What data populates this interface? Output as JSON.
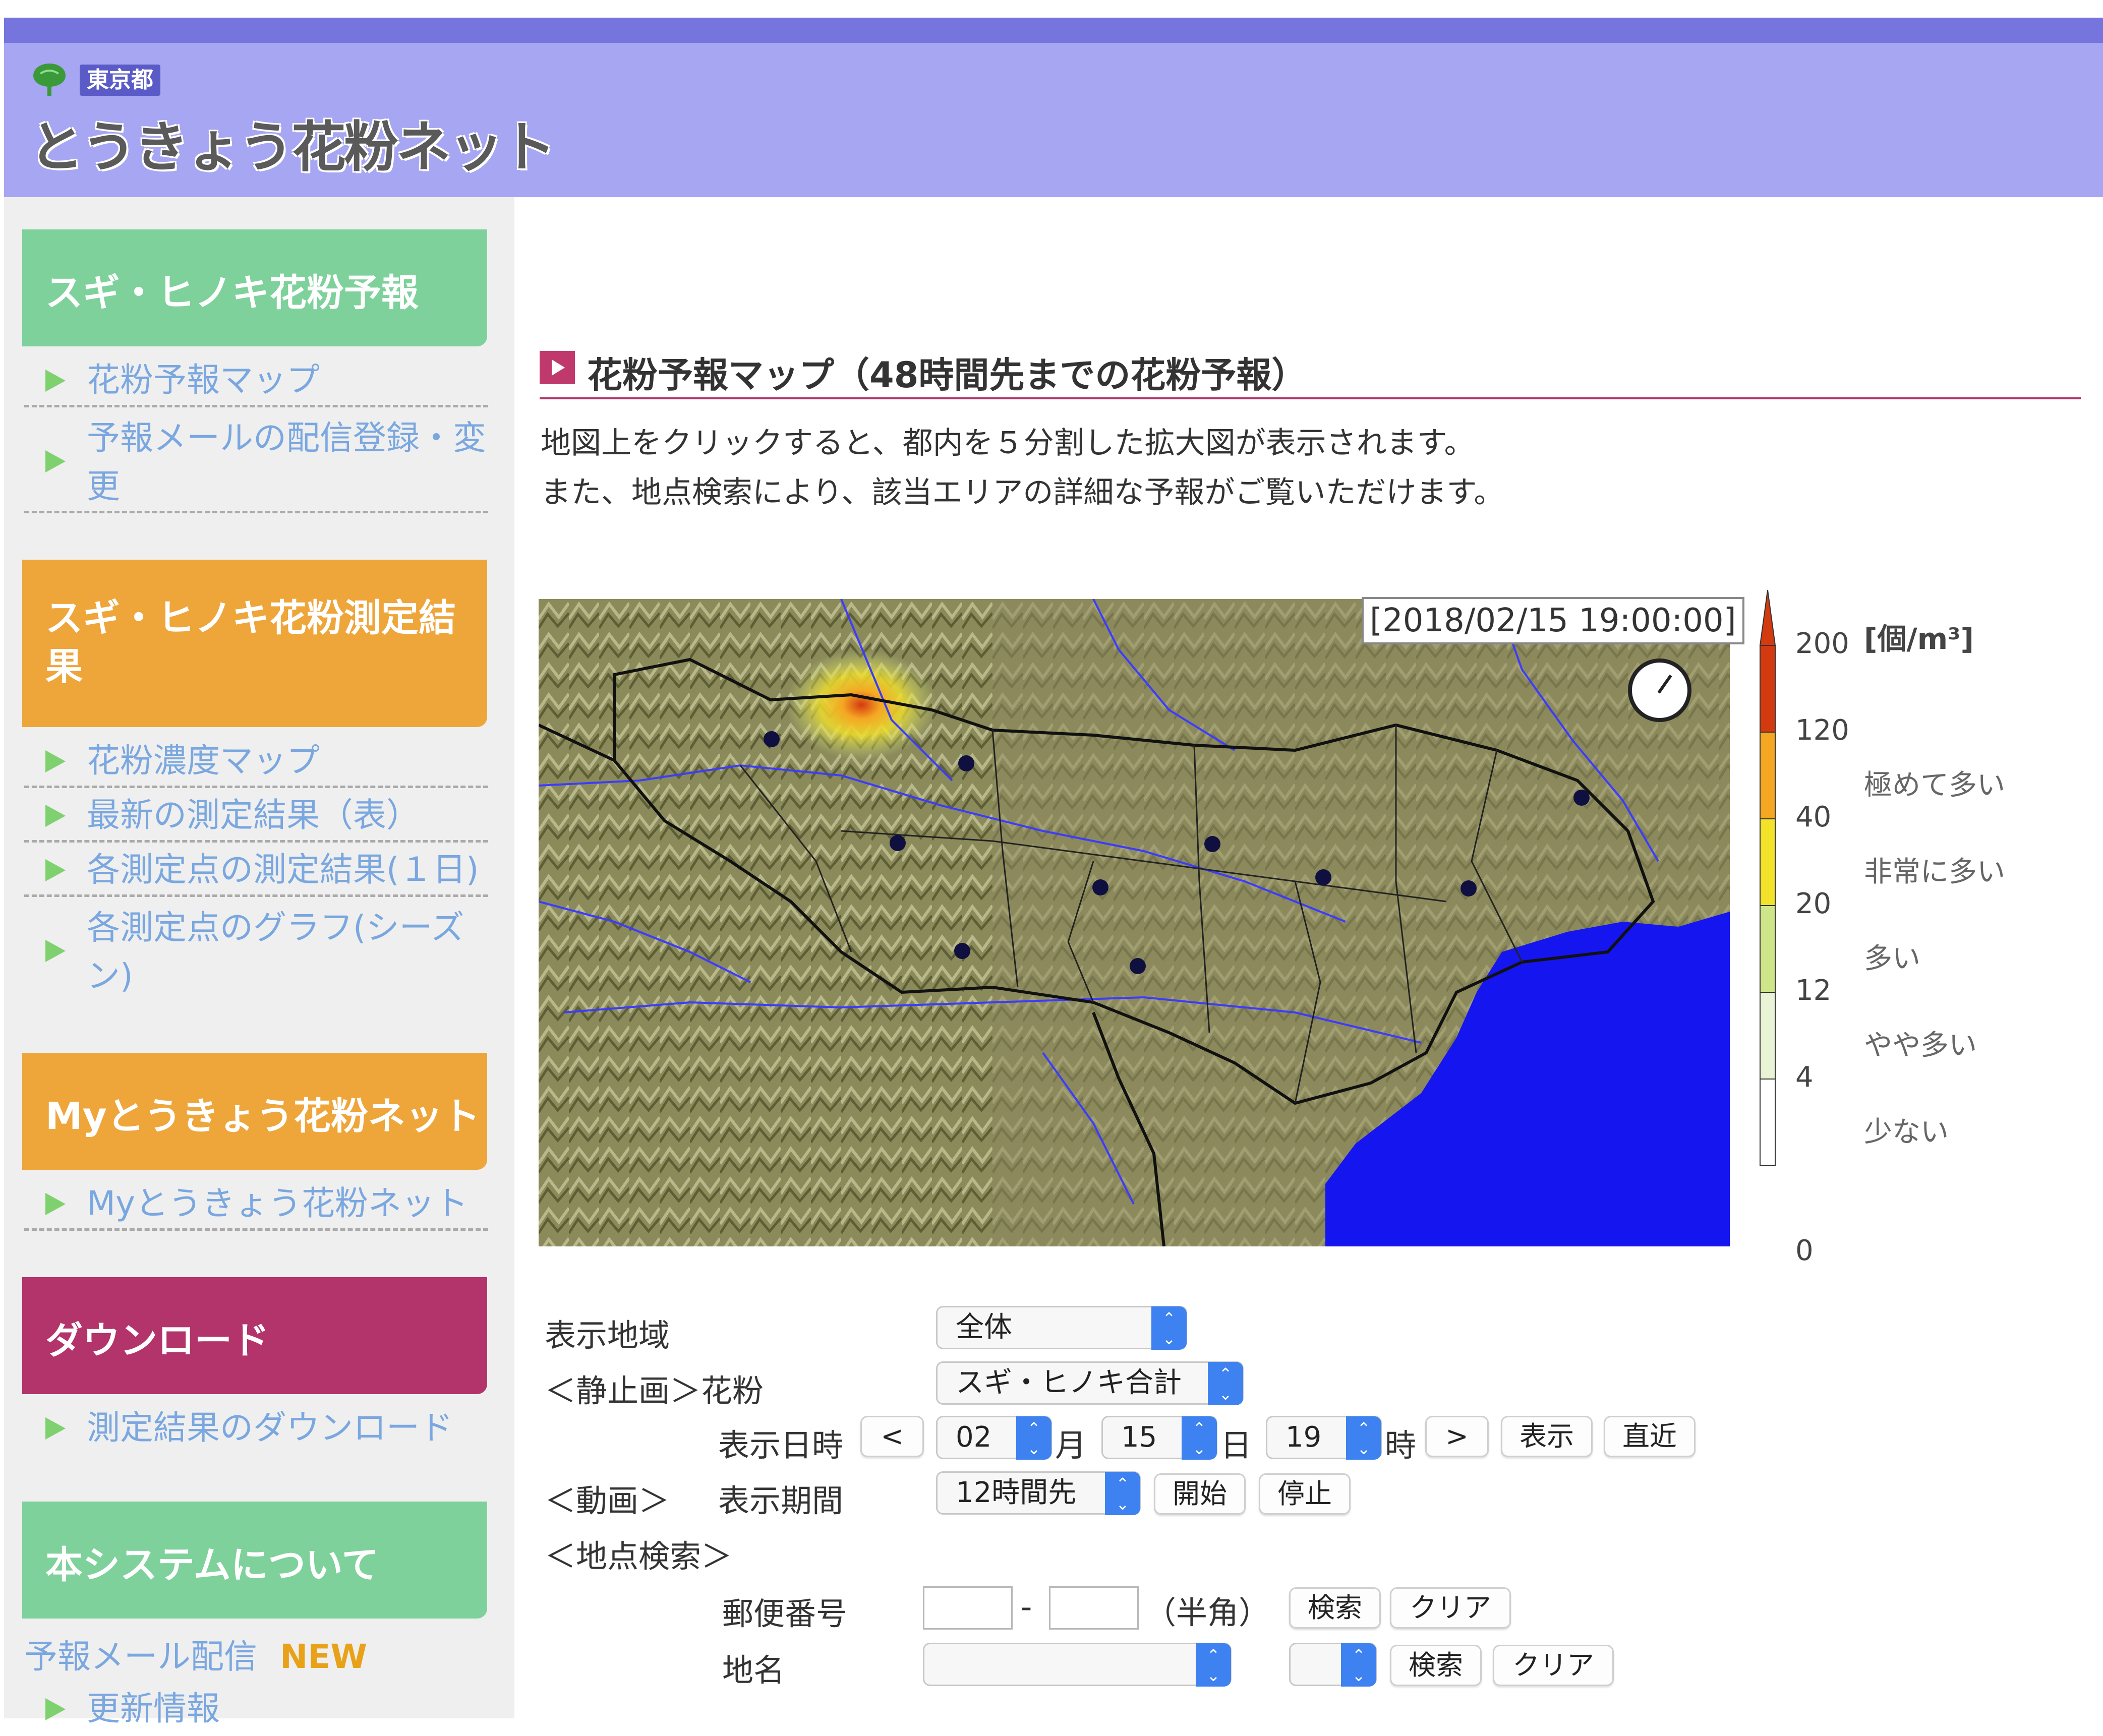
{
  "header": {
    "badge": "東京都",
    "site_name": "とうきょう花粉ネット"
  },
  "sidebar": {
    "sections": [
      {
        "title": "スギ・ヒノキ花粉予報",
        "items": [
          "花粉予報マップ",
          "予報メールの配信登録・変更"
        ]
      },
      {
        "title": "スギ・ヒノキ花粉測定結果",
        "items": [
          "花粉濃度マップ",
          "最新の測定結果（表）",
          "各測定点の測定結果(１日)",
          "各測定点のグラフ(シーズン)"
        ]
      },
      {
        "title": "Myとうきょう花粉ネット",
        "items": [
          "Myとうきょう花粉ネット"
        ]
      },
      {
        "title": "ダウンロード",
        "items": [
          "測定結果のダウンロード"
        ]
      },
      {
        "title": "本システムについて",
        "items": [
          "更新情報"
        ]
      }
    ],
    "mail_link": "予報メール配信",
    "new_badge": "NEW"
  },
  "main": {
    "section_title": "花粉予報マップ（48時間先までの花粉予報）",
    "description": [
      "地図上をクリックすると、都内を５分割した拡大図が表示されます。",
      "また、地点検索により、該当エリアの詳細な予報がご覧いただけます。"
    ],
    "map": {
      "timestamp": "[2018/02/15 19:00:00]"
    },
    "legend": {
      "unit": "[個/m³]",
      "ticks": [
        "200",
        "120",
        "40",
        "20",
        "12",
        "4",
        "0"
      ],
      "levels": [
        "極めて多い",
        "非常に多い",
        "多い",
        "やや多い",
        "少ない"
      ],
      "colors": [
        "#d43a10",
        "#f5a623",
        "#f2e22a",
        "#cfe58a",
        "#e9f4d6",
        "#ffffff"
      ]
    },
    "form": {
      "area_label": "表示地域",
      "area_value": "全体",
      "still_label": "＜静止画＞花粉",
      "pollen_value": "スギ・ヒノキ合計",
      "datetime_label": "表示日時",
      "prev_btn": "<",
      "month_value": "02",
      "month_unit": "月",
      "day_value": "15",
      "day_unit": "日",
      "hour_value": "19",
      "hour_unit": "時",
      "next_btn": ">",
      "show_btn": "表示",
      "latest_btn": "直近",
      "movie_label": "＜動画＞",
      "period_label": "表示期間",
      "period_value": "12時間先",
      "start_btn": "開始",
      "stop_btn": "停止",
      "search_label": "＜地点検索＞",
      "zip_label": "郵便番号",
      "zip_sep": "-",
      "zip_note": "（半角）",
      "search_btn": "検索",
      "clear_btn": "クリア",
      "place_label": "地名",
      "search_btn2": "検索",
      "clear_btn2": "クリア"
    }
  }
}
